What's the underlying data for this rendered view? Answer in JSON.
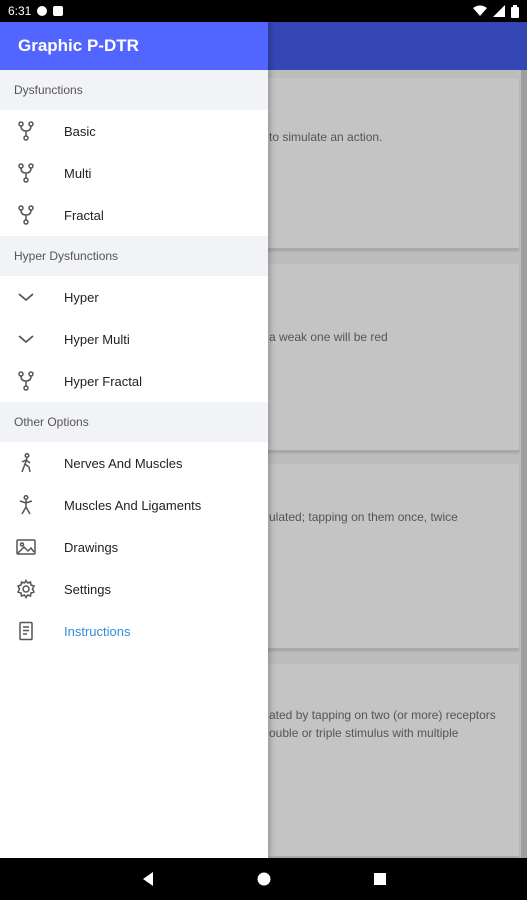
{
  "status_bar": {
    "time": "6:31"
  },
  "drawer": {
    "title": "Graphic P-DTR",
    "sections": [
      {
        "header": "Dysfunctions",
        "items": [
          {
            "label": "Basic",
            "icon": "fork-icon"
          },
          {
            "label": "Multi",
            "icon": "fork-icon"
          },
          {
            "label": "Fractal",
            "icon": "fork-icon"
          }
        ]
      },
      {
        "header": "Hyper Dysfunctions",
        "items": [
          {
            "label": "Hyper",
            "icon": "chevron-down-icon"
          },
          {
            "label": "Hyper Multi",
            "icon": "chevron-down-icon"
          },
          {
            "label": "Hyper Fractal",
            "icon": "fork-icon"
          }
        ]
      },
      {
        "header": "Other Options",
        "items": [
          {
            "label": "Nerves And Muscles",
            "icon": "walking-person-icon"
          },
          {
            "label": "Muscles And Ligaments",
            "icon": "standing-person-icon"
          },
          {
            "label": "Drawings",
            "icon": "image-icon"
          },
          {
            "label": "Settings",
            "icon": "gear-icon"
          },
          {
            "label": "Instructions",
            "icon": "document-icon",
            "active": true
          }
        ]
      }
    ]
  },
  "background_content": {
    "cards": [
      {
        "lines": [
          "to simulate an action."
        ]
      },
      {
        "lines": [
          "a weak one will be red"
        ]
      },
      {
        "lines": [
          "ulated; tapping on them once, twice"
        ]
      },
      {
        "lines": [
          "ated by tapping on two (or more) receptors",
          "ouble or triple stimulus with multiple"
        ]
      }
    ]
  },
  "colors": {
    "drawer_header": "#5265ff",
    "app_bar_dimmed": "#3346b3",
    "active_item": "#2f8fd8"
  }
}
